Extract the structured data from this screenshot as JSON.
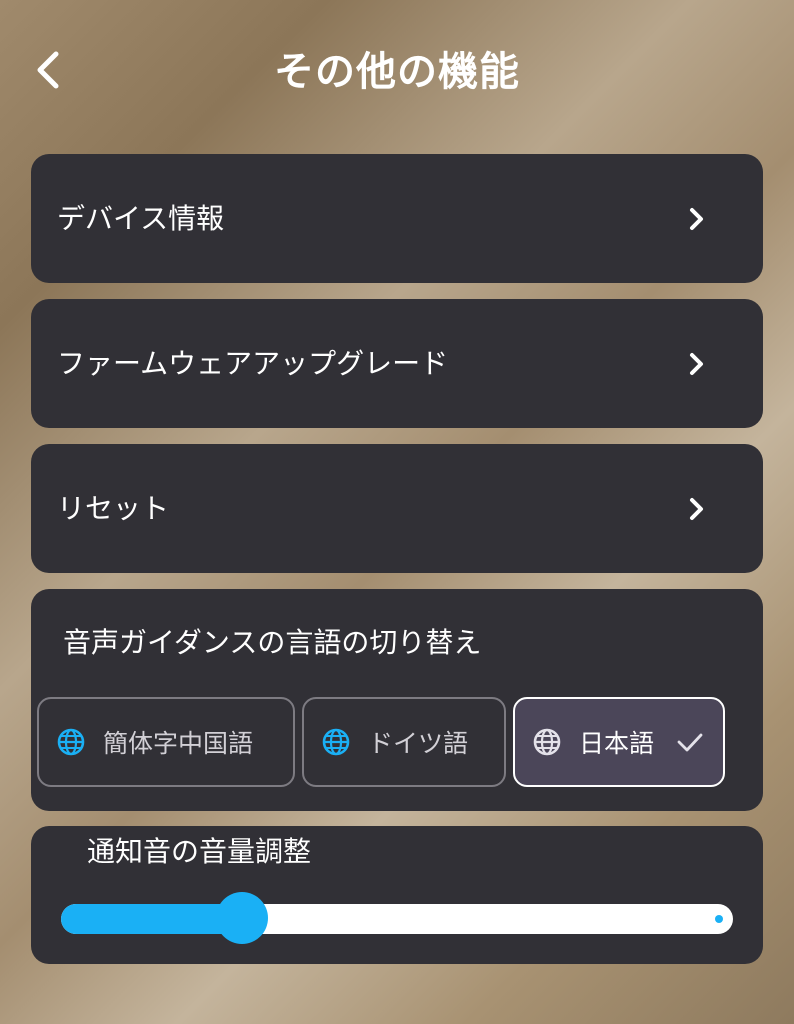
{
  "header": {
    "title": "その他の機能",
    "back_icon": "chevron-left-icon"
  },
  "menu": {
    "device_info": "デバイス情報",
    "firmware_upgrade": "ファームウェアアップグレード",
    "reset": "リセット",
    "chevron_icon": "chevron-right-icon"
  },
  "voice_guidance": {
    "title": "音声ガイダンスの言語の切り替え",
    "options": [
      {
        "label": "簡体字中国語",
        "icon": "globe-icon",
        "selected": false
      },
      {
        "label": "ドイツ語",
        "icon": "globe-icon",
        "selected": false
      },
      {
        "label": "日本語",
        "icon": "globe-icon",
        "selected": true
      }
    ],
    "selected_icon": "check-icon"
  },
  "volume": {
    "title": "通知音の音量調整",
    "level": 0.25
  },
  "colors": {
    "accent": "#1ab0f5",
    "card": "#313036",
    "selected_bg": "#4b4659"
  }
}
